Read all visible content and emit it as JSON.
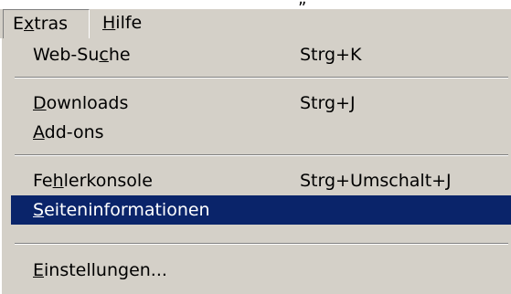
{
  "menubar": {
    "extras": {
      "pre": "E",
      "key": "x",
      "post": "tras"
    },
    "help": {
      "pre": "",
      "key": "H",
      "post": "ilfe"
    }
  },
  "top_glyph": "„",
  "menu": {
    "items": [
      {
        "pre": "Web-Su",
        "key": "c",
        "post": "he",
        "shortcut": "Strg+K"
      },
      {
        "pre": "",
        "key": "D",
        "post": "ownloads",
        "shortcut": "Strg+J"
      },
      {
        "pre": "",
        "key": "A",
        "post": "dd-ons",
        "shortcut": ""
      },
      {
        "pre": "Fe",
        "key": "h",
        "post": "lerkonsole",
        "shortcut": "Strg+Umschalt+J"
      },
      {
        "pre": "",
        "key": "S",
        "post": "eiteninformationen",
        "shortcut": ""
      },
      {
        "pre": "",
        "key": "E",
        "post": "instellungen...",
        "shortcut": ""
      }
    ]
  },
  "colors": {
    "menu_background": "#d4d0c8",
    "highlight_background": "#0a246a",
    "highlight_text": "#ffffff"
  }
}
